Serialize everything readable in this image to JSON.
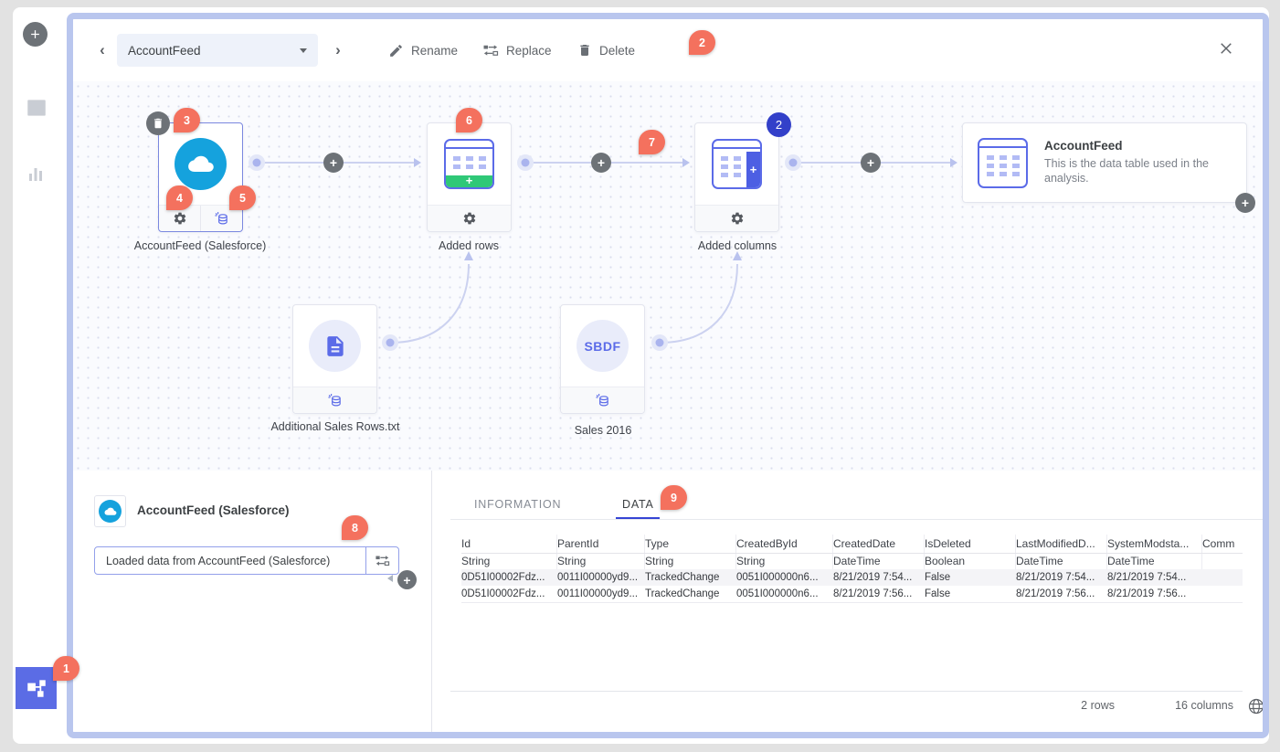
{
  "colors": {
    "accent_blue": "#5b6be8",
    "annotation_badge": "#f4715e",
    "count_badge": "#3340c9",
    "salesforce_blue": "#15a2dd",
    "added_rows_green": "#2fc877",
    "window_border": "#b9c6ee"
  },
  "annotations": [
    "1",
    "2",
    "3",
    "4",
    "5",
    "6",
    "7",
    "8",
    "9"
  ],
  "toolbar": {
    "selected_table": "AccountFeed",
    "rename_label": "Rename",
    "replace_label": "Replace",
    "delete_label": "Delete"
  },
  "canvas": {
    "nodes": [
      {
        "label": "AccountFeed (Salesforce)"
      },
      {
        "label": "Added rows"
      },
      {
        "label": "Added columns",
        "count": "2"
      },
      {
        "title": "AccountFeed",
        "description": "This is the data table used in the analysis."
      },
      {
        "label": "Additional Sales Rows.txt"
      },
      {
        "label": "Sales 2016",
        "file_type": "SBDF"
      }
    ]
  },
  "details_panel": {
    "title": "AccountFeed (Salesforce)",
    "operation": "Loaded data from AccountFeed (Salesforce)"
  },
  "data_panel": {
    "tabs": {
      "information": "INFORMATION",
      "data": "DATA"
    },
    "columns": [
      {
        "name": "Id",
        "type": "String"
      },
      {
        "name": "ParentId",
        "type": "String"
      },
      {
        "name": "Type",
        "type": "String"
      },
      {
        "name": "CreatedById",
        "type": "String"
      },
      {
        "name": "CreatedDate",
        "type": "DateTime"
      },
      {
        "name": "IsDeleted",
        "type": "Boolean"
      },
      {
        "name": "LastModifiedD...",
        "type": "DateTime"
      },
      {
        "name": "SystemModsta...",
        "type": "DateTime"
      },
      {
        "name": "Comm",
        "type": ""
      }
    ],
    "rows": [
      [
        "0D51I00002Fdz...",
        "0011I00000yd9...",
        "TrackedChange",
        "0051I000000n6...",
        "8/21/2019 7:54...",
        "False",
        "8/21/2019 7:54...",
        "8/21/2019 7:54...",
        ""
      ],
      [
        "0D51I00002Fdz...",
        "0011I00000yd9...",
        "TrackedChange",
        "0051I000000n6...",
        "8/21/2019 7:56...",
        "False",
        "8/21/2019 7:56...",
        "8/21/2019 7:56...",
        ""
      ]
    ],
    "footer": {
      "row_count": "2 rows",
      "column_count": "16 columns"
    }
  }
}
